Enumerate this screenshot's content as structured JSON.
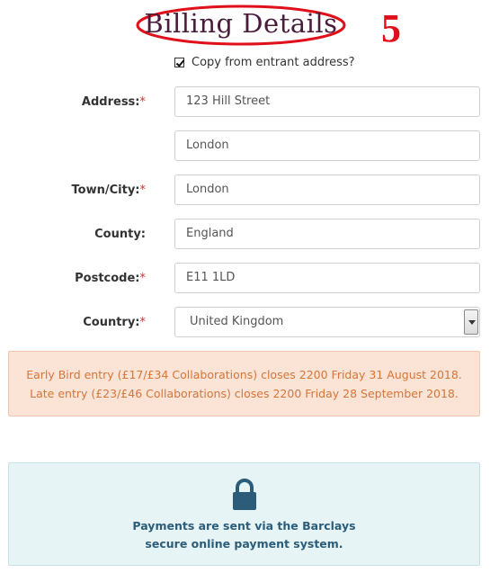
{
  "header": {
    "title": "Billing Details",
    "step": "5"
  },
  "copy_address": {
    "label": "Copy from entrant address?",
    "checked": true
  },
  "form": {
    "address_label": "Address:",
    "address_line1": "123 Hill Street",
    "address_line2": "London",
    "town_label": "Town/City:",
    "town": "London",
    "county_label": "County:",
    "county": "England",
    "postcode_label": "Postcode:",
    "postcode": "E11 1LD",
    "country_label": "Country:",
    "country": "United Kingdom",
    "required_mark": "*"
  },
  "notice": {
    "line1": "Early Bird entry (£17/£34 Collaborations) closes 2200 Friday 31 August 2018.",
    "line2": "Late entry (£23/£46 Collaborations) closes 2200 Friday 28 September 2018."
  },
  "payment_info": {
    "line1": "Payments are sent via the Barclays",
    "line2": "secure online payment system.",
    "icon": "lock-icon"
  },
  "colors": {
    "title": "#4a1c3c",
    "annotation_red": "#e0101a",
    "notice_bg": "#fbe3d5",
    "notice_text": "#d5763a",
    "info_bg": "#e6f4f5",
    "info_text": "#2b5d7a"
  }
}
